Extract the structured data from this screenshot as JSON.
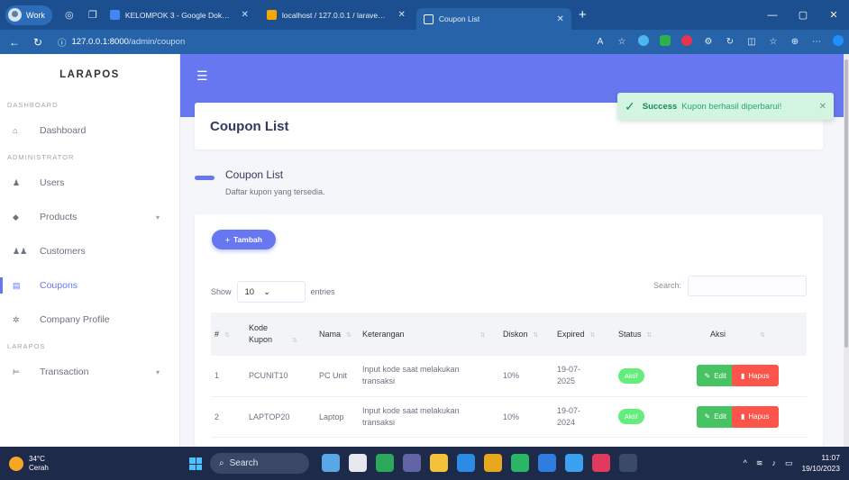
{
  "browser": {
    "profile": "Work",
    "tabs": [
      {
        "title": "KELOMPOK 3 - Google Dokumen",
        "color": "#4285f4",
        "active": false
      },
      {
        "title": "localhost / 127.0.0.1 / laravel_lar",
        "color": "#f7a800",
        "active": false
      },
      {
        "title": "Coupon List",
        "color": "#ffffff",
        "active": true
      }
    ],
    "url_host": "127.0.0.1:8000",
    "url_path": "/admin/coupon"
  },
  "sidebar": {
    "brand": "LARAPOS",
    "sections": [
      "DASHBOARD",
      "ADMINISTRATOR",
      "LARAPOS"
    ],
    "items": [
      {
        "label": "Dashboard",
        "icon": "home-icon"
      },
      {
        "label": "Users",
        "icon": "user-icon"
      },
      {
        "label": "Products",
        "icon": "box-icon"
      },
      {
        "label": "Customers",
        "icon": "users-icon"
      },
      {
        "label": "Coupons",
        "icon": "coupon-icon"
      },
      {
        "label": "Company Profile",
        "icon": "gear-icon"
      },
      {
        "label": "Transaction",
        "icon": "cart-icon"
      }
    ]
  },
  "toast": {
    "title": "Success",
    "message": "Kupon berhasil diperbarui!"
  },
  "page": {
    "title": "Coupon List",
    "section_title": "Coupon List",
    "section_subtitle": "Daftar kupon yang tersedia."
  },
  "toolbar": {
    "add_label": "Tambah"
  },
  "table_controls": {
    "show": "Show",
    "entries_value": "10",
    "entries": "entries",
    "search": "Search:"
  },
  "table": {
    "headers": [
      "#",
      "Kode Kupon",
      "Nama",
      "Keterangan",
      "Diskon",
      "Expired",
      "Status",
      "Aksi"
    ],
    "rows": [
      {
        "no": "1",
        "kode": "PCUNIT10",
        "nama": "PC Unit",
        "keterangan": "Input kode saat melakukan transaksi",
        "diskon": "10%",
        "expired": "19-07-2025",
        "status": "Aktif"
      },
      {
        "no": "2",
        "kode": "LAPTOP20",
        "nama": "Laptop",
        "keterangan": "Input kode saat melakukan transaksi",
        "diskon": "10%",
        "expired": "19-07-2024",
        "status": "Aktif"
      }
    ],
    "edit_label": "Edit",
    "delete_label": "Hapus"
  },
  "taskbar": {
    "temp": "34°C",
    "weather": "Cerah",
    "search": "Search",
    "time": "11:07",
    "date": "19/10/2023"
  },
  "colors": {
    "primary": "#6777ef",
    "success": "#47c363",
    "danger": "#fc544b",
    "badge": "#63ed7a"
  }
}
